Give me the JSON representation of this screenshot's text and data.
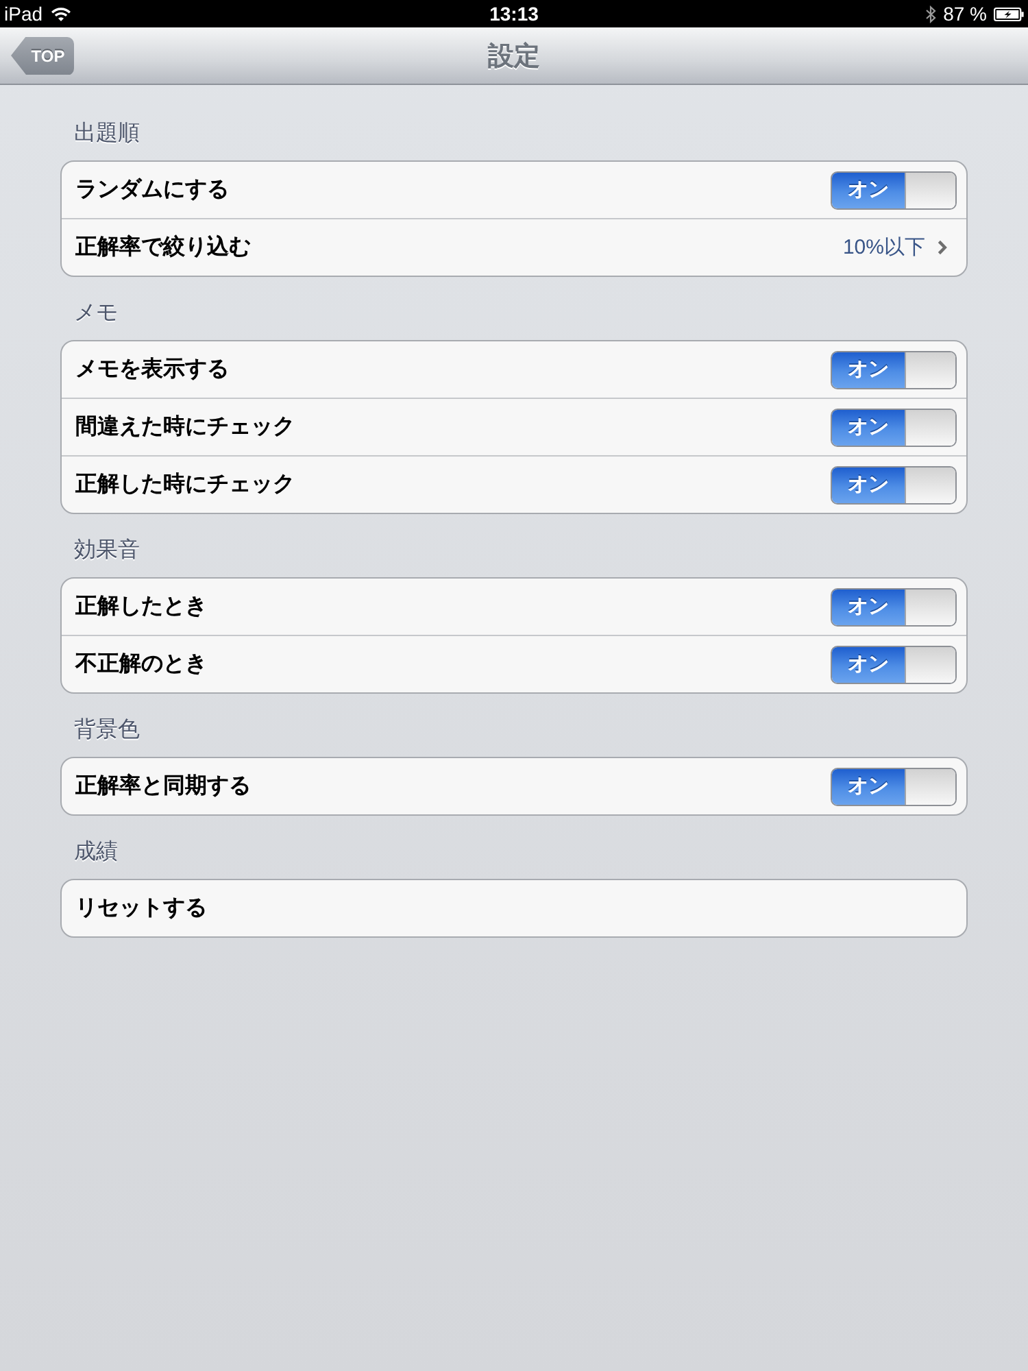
{
  "status_bar": {
    "device": "iPad",
    "time": "13:13",
    "battery": "87 %"
  },
  "nav_bar": {
    "back_button": "TOP",
    "title": "設定"
  },
  "sections": [
    {
      "header": "出題順",
      "rows": [
        {
          "label": "ランダムにする",
          "kind": "switch",
          "switch": {
            "label": "オン",
            "on": true
          }
        },
        {
          "label": "正解率で絞り込む",
          "kind": "disclosure",
          "value": "10%以下"
        }
      ]
    },
    {
      "header": "メモ",
      "rows": [
        {
          "label": "メモを表示する",
          "kind": "switch",
          "switch": {
            "label": "オン",
            "on": true
          }
        },
        {
          "label": "間違えた時にチェック",
          "kind": "switch",
          "switch": {
            "label": "オン",
            "on": true
          }
        },
        {
          "label": "正解した時にチェック",
          "kind": "switch",
          "switch": {
            "label": "オン",
            "on": true
          }
        }
      ]
    },
    {
      "header": "効果音",
      "rows": [
        {
          "label": "正解したとき",
          "kind": "switch",
          "switch": {
            "label": "オン",
            "on": true
          }
        },
        {
          "label": "不正解のとき",
          "kind": "switch",
          "switch": {
            "label": "オン",
            "on": true
          }
        }
      ]
    },
    {
      "header": "背景色",
      "rows": [
        {
          "label": "正解率と同期する",
          "kind": "switch",
          "switch": {
            "label": "オン",
            "on": true
          }
        }
      ]
    },
    {
      "header": "成績",
      "rows": [
        {
          "label": "リセットする",
          "kind": "action"
        }
      ]
    }
  ]
}
